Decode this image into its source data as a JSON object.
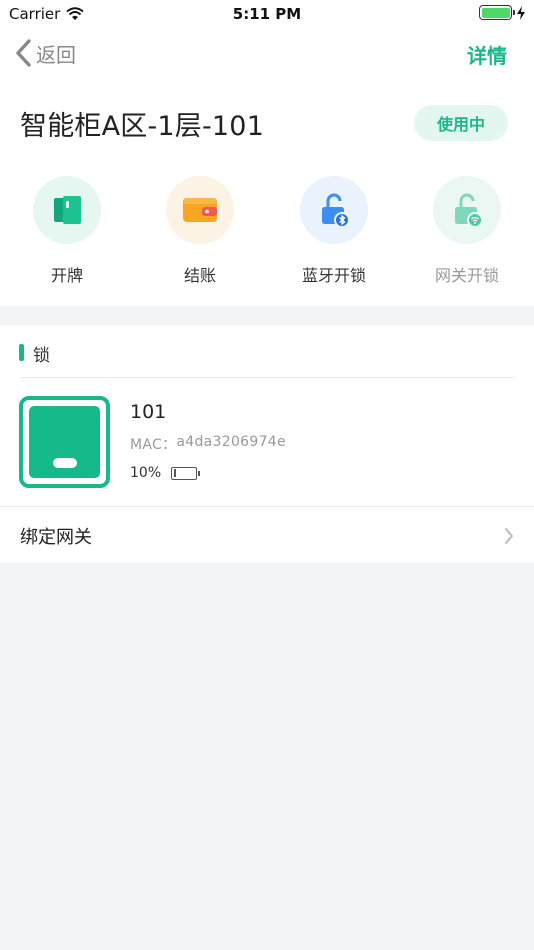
{
  "status_bar": {
    "carrier": "Carrier",
    "time": "5:11 PM"
  },
  "nav": {
    "back_label": "返回",
    "detail_label": "详情"
  },
  "header": {
    "title": "智能柜A区-1层-101",
    "status": "使用中"
  },
  "actions": [
    {
      "label": "开牌",
      "icon": "card-icon",
      "bg": "#e6f6f0"
    },
    {
      "label": "结账",
      "icon": "wallet-icon",
      "bg": "#fdf3e4"
    },
    {
      "label": "蓝牙开锁",
      "icon": "bluetooth-unlock-icon",
      "bg": "#e9f2fd"
    },
    {
      "label": "网关开锁",
      "icon": "gateway-unlock-icon",
      "bg": "#eaf7f2",
      "disabled": true
    }
  ],
  "lock_section": {
    "title": "锁",
    "lock": {
      "name": "101",
      "mac_label": "MAC：",
      "mac_value": "a4da3206974e",
      "battery": "10%"
    },
    "bind_gateway_label": "绑定网关"
  },
  "colors": {
    "accent": "#19b88a",
    "background": "#f3f4f6",
    "bluetooth": "#3d8ef0",
    "wallet": "#f6a623"
  }
}
